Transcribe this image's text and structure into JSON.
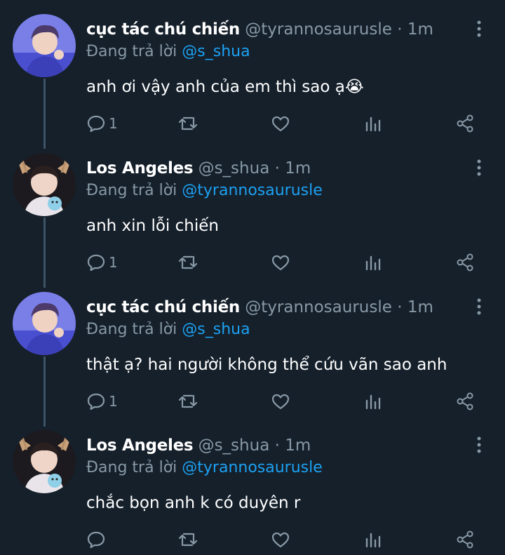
{
  "tweets": [
    {
      "name": "cục tác chú chiến",
      "handle": "@tyrannosaurusle",
      "time": "1m",
      "replying_prefix": "Đang trả lời",
      "replying_to": "@s_shua",
      "text": "anh ơi vậy anh của em thì sao ạ😭",
      "reply_count": "1",
      "avatar": "avatar-purple-idol"
    },
    {
      "name": "Los Angeles",
      "handle": "@s_shua",
      "time": "1m",
      "replying_prefix": "Đang trả lời",
      "replying_to": "@tyrannosaurusle",
      "text": "anh xin lỗi chiến",
      "reply_count": "1",
      "avatar": "avatar-deer-ears"
    },
    {
      "name": "cục tác chú chiến",
      "handle": "@tyrannosaurusle",
      "time": "1m",
      "replying_prefix": "Đang trả lời",
      "replying_to": "@s_shua",
      "text": "thật ạ? hai người không thể cứu vãn sao anh",
      "reply_count": "1",
      "avatar": "avatar-purple-idol"
    },
    {
      "name": "Los Angeles",
      "handle": "@s_shua",
      "time": "1m",
      "replying_prefix": "Đang trả lời",
      "replying_to": "@tyrannosaurusle",
      "text": "chắc bọn anh k có duyên r",
      "reply_count": "",
      "avatar": "avatar-deer-ears"
    }
  ],
  "separator": "·",
  "colors": {
    "background": "#15202b",
    "text": "#ffffff",
    "muted": "#8899a6",
    "link": "#1da1f2",
    "thread_line": "#3d5466"
  },
  "icons": [
    "reply-icon",
    "retweet-icon",
    "like-icon",
    "analytics-icon",
    "share-icon",
    "more-icon"
  ]
}
